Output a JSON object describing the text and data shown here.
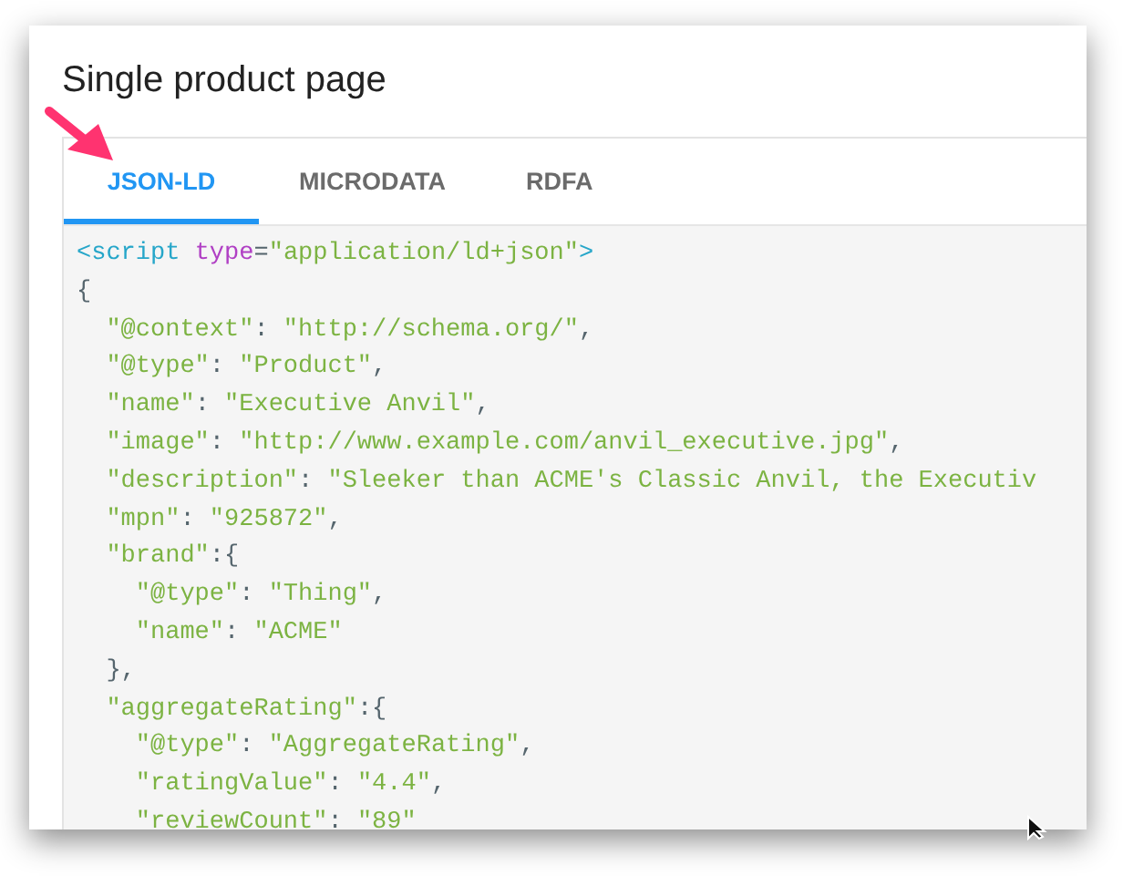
{
  "title": "Single product page",
  "tabs": [
    {
      "label": "JSON-LD",
      "selected": true
    },
    {
      "label": "MICRODATA",
      "selected": false
    },
    {
      "label": "RDFA",
      "selected": false
    }
  ],
  "code_lines": [
    [
      {
        "kind": "tag",
        "text": "<script"
      },
      {
        "kind": "attr",
        "text": " type"
      },
      {
        "kind": "punct",
        "text": "="
      },
      {
        "kind": "string",
        "text": "\"application/ld+json\""
      },
      {
        "kind": "tag",
        "text": ">"
      }
    ],
    [
      {
        "kind": "punct",
        "text": "{"
      }
    ],
    [
      {
        "kind": "string",
        "text": "  \"@context\""
      },
      {
        "kind": "punct",
        "text": ": "
      },
      {
        "kind": "string",
        "text": "\"http://schema.org/\""
      },
      {
        "kind": "punct",
        "text": ","
      }
    ],
    [
      {
        "kind": "string",
        "text": "  \"@type\""
      },
      {
        "kind": "punct",
        "text": ": "
      },
      {
        "kind": "string",
        "text": "\"Product\""
      },
      {
        "kind": "punct",
        "text": ","
      }
    ],
    [
      {
        "kind": "string",
        "text": "  \"name\""
      },
      {
        "kind": "punct",
        "text": ": "
      },
      {
        "kind": "string",
        "text": "\"Executive Anvil\""
      },
      {
        "kind": "punct",
        "text": ","
      }
    ],
    [
      {
        "kind": "string",
        "text": "  \"image\""
      },
      {
        "kind": "punct",
        "text": ": "
      },
      {
        "kind": "string",
        "text": "\"http://www.example.com/anvil_executive.jpg\""
      },
      {
        "kind": "punct",
        "text": ","
      }
    ],
    [
      {
        "kind": "string",
        "text": "  \"description\""
      },
      {
        "kind": "punct",
        "text": ": "
      },
      {
        "kind": "string",
        "text": "\"Sleeker than ACME's Classic Anvil, the Executiv"
      }
    ],
    [
      {
        "kind": "string",
        "text": "  \"mpn\""
      },
      {
        "kind": "punct",
        "text": ": "
      },
      {
        "kind": "string",
        "text": "\"925872\""
      },
      {
        "kind": "punct",
        "text": ","
      }
    ],
    [
      {
        "kind": "string",
        "text": "  \"brand\""
      },
      {
        "kind": "punct",
        "text": ":{"
      }
    ],
    [
      {
        "kind": "string",
        "text": "    \"@type\""
      },
      {
        "kind": "punct",
        "text": ": "
      },
      {
        "kind": "string",
        "text": "\"Thing\""
      },
      {
        "kind": "punct",
        "text": ","
      }
    ],
    [
      {
        "kind": "string",
        "text": "    \"name\""
      },
      {
        "kind": "punct",
        "text": ": "
      },
      {
        "kind": "string",
        "text": "\"ACME\""
      }
    ],
    [
      {
        "kind": "punct",
        "text": "  },"
      }
    ],
    [
      {
        "kind": "string",
        "text": "  \"aggregateRating\""
      },
      {
        "kind": "punct",
        "text": ":{"
      }
    ],
    [
      {
        "kind": "string",
        "text": "    \"@type\""
      },
      {
        "kind": "punct",
        "text": ": "
      },
      {
        "kind": "string",
        "text": "\"AggregateRating\""
      },
      {
        "kind": "punct",
        "text": ","
      }
    ],
    [
      {
        "kind": "string",
        "text": "    \"ratingValue\""
      },
      {
        "kind": "punct",
        "text": ": "
      },
      {
        "kind": "string",
        "text": "\"4.4\""
      },
      {
        "kind": "punct",
        "text": ","
      }
    ],
    [
      {
        "kind": "string",
        "text": "    \"reviewCount\""
      },
      {
        "kind": "punct",
        "text": ": "
      },
      {
        "kind": "string",
        "text": "\"89\""
      }
    ]
  ]
}
